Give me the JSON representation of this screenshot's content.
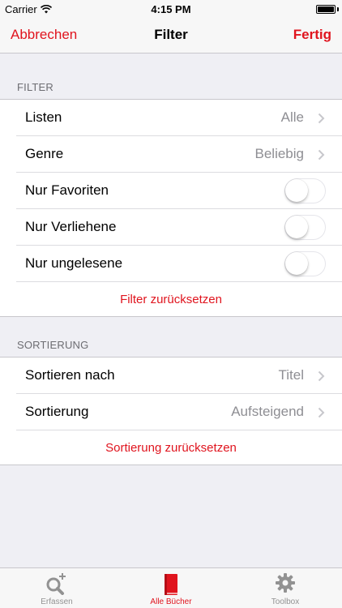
{
  "status_bar": {
    "carrier": "Carrier",
    "time": "4:15 PM"
  },
  "nav": {
    "cancel_label": "Abbrechen",
    "title": "Filter",
    "done_label": "Fertig"
  },
  "filter_section": {
    "header": "FILTER",
    "rows": [
      {
        "label": "Listen",
        "value": "Alle"
      },
      {
        "label": "Genre",
        "value": "Beliebig"
      }
    ],
    "toggles": [
      {
        "label": "Nur Favoriten",
        "on": false
      },
      {
        "label": "Nur Verliehene",
        "on": false
      },
      {
        "label": "Nur ungelesene",
        "on": false
      }
    ],
    "reset_label": "Filter zurücksetzen"
  },
  "sort_section": {
    "header": "SORTIERUNG",
    "rows": [
      {
        "label": "Sortieren nach",
        "value": "Titel"
      },
      {
        "label": "Sortierung",
        "value": "Aufsteigend"
      }
    ],
    "reset_label": "Sortierung zurücksetzen"
  },
  "tab_bar": {
    "tabs": [
      {
        "label": "Erfassen",
        "icon": "search-plus-icon",
        "active": false
      },
      {
        "label": "Alle Bücher",
        "icon": "book-icon",
        "active": true
      },
      {
        "label": "Toolbox",
        "icon": "gear-icon",
        "active": false
      }
    ]
  },
  "colors": {
    "accent": "#e0141e",
    "secondary_text": "#8e8e93",
    "background": "#efeff4"
  }
}
